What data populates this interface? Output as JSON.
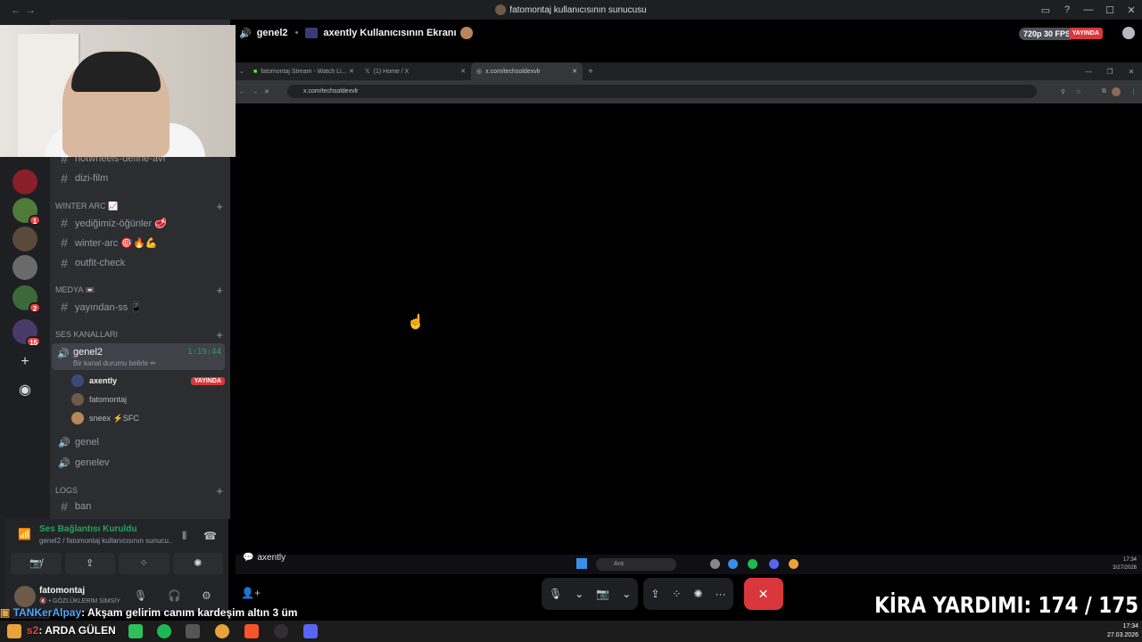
{
  "window": {
    "title": "fatomontaj kullanıcısının sunucusu",
    "back": "←",
    "forward": "→",
    "controls": [
      "▭",
      "?",
      "—",
      "☐",
      "✕"
    ]
  },
  "servers": [
    {
      "badge": ""
    },
    {
      "badge": "1"
    },
    {
      "badge": ""
    },
    {
      "badge": ""
    },
    {
      "badge": "2"
    },
    {
      "badge": "15"
    }
  ],
  "rail_buttons": {
    "add": "+",
    "discover": "◉"
  },
  "channels": {
    "top_partial": "hotwheels-define-avı",
    "dizi": "dizi-film",
    "winter_category": "WINTER ARC 📈",
    "winter_items": [
      "yediğimiz-öğünler 🥩",
      "winter-arc 🎯🔥💪",
      "outfit-check"
    ],
    "medya_category": "MEDYA 📼",
    "medya_items": [
      "yayından-ss 📱"
    ],
    "voice_category": "Ses Kanalları",
    "active_voice": {
      "name": "genel2",
      "status": "Bir kanal durumu belirle ✏",
      "timer": "1:19:44"
    },
    "members": [
      {
        "name": "axently",
        "live": "YAYINDA"
      },
      {
        "name": "fatomontaj",
        "live": ""
      },
      {
        "name": "sneex ⚡SFC",
        "live": ""
      }
    ],
    "other_voice": [
      "genel",
      "genelev"
    ],
    "logs_category": "LOGS",
    "logs_items": [
      "ban"
    ]
  },
  "voice_panel": {
    "connected": "Ses Bağlantısı Kuruldu",
    "sub": "genel2 / fatomontaj kullanıcısının sunucu...",
    "buttons": [
      "📷̸",
      "⇪",
      "⁘",
      "✺"
    ]
  },
  "user_panel": {
    "name": "fatomontaj",
    "status": "🔇 • GÖZLÜKLERİM SİMSİY"
  },
  "stream": {
    "channel": "genel2",
    "screen_title": "axently Kullanıcısının Ekranı",
    "quality": "720p 30 FPS",
    "live": "YAYINDA",
    "viewer": "axently"
  },
  "browser": {
    "tabs": [
      {
        "label": "fatomontaj Stream - Watch Li...",
        "active": false
      },
      {
        "label": "(1) Home / X",
        "active": false
      },
      {
        "label": "x.com/techsoldexvlr",
        "active": true
      }
    ],
    "new_tab": "+",
    "url": "x.com/techsoldexvlr"
  },
  "inner_taskbar": {
    "search": "Ara",
    "time": "17:34",
    "date": "3/27/2026"
  },
  "overlay": {
    "rent": "KİRA YARDIMI:  174 / 175"
  },
  "chat": {
    "user": "TANKerAlpay",
    "message": ": Akşam gelirim canım kardeşim altın 3 üm"
  },
  "taskbar": {
    "now_prefix": "s2",
    "now_playing": ": ARDA GÜLEN",
    "time": "17:34",
    "date": "27.03.2026"
  }
}
